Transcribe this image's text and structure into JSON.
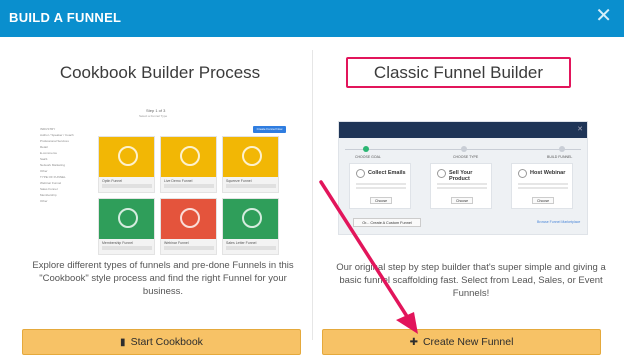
{
  "header": {
    "title": "BUILD A FUNNEL",
    "close_icon": "close-icon"
  },
  "left": {
    "title": "Cookbook Builder Process",
    "description": "Explore different types of funnels and pre-done Funnels in this \"Cookbook\" style process and find the right Funnel for your business.",
    "button_label": "Start Cookbook",
    "button_icon": "book-icon",
    "preview": {
      "step": "Step 1 of 3",
      "subtitle": "Select a Funnel Type",
      "corner_button": "Create Funnel Now",
      "sidebar": [
        "INDUSTRY",
        "Author / Speaker / Coach",
        "Professional Services",
        "Retail",
        "E-commerce",
        "SaaS",
        "Network Marketing",
        "Other",
        "TYPE OF FUNNEL",
        "Webinar Funnel",
        "Sales Funnel",
        "Membership",
        "Other"
      ],
      "cards": [
        {
          "label": "Optin Funnel",
          "color": "#f2b705"
        },
        {
          "label": "Live Demo Funnel",
          "color": "#f2b705"
        },
        {
          "label": "Squeeze Funnel",
          "color": "#f2b705"
        },
        {
          "label": "Membership Funnel",
          "color": "#2f9e5a"
        },
        {
          "label": "Webinar Funnel",
          "color": "#e4543c"
        },
        {
          "label": "Sales Letter Funnel",
          "color": "#2f9e5a"
        }
      ]
    }
  },
  "right": {
    "title": "Classic Funnel Builder",
    "description": "Our original step by step builder that's super simple and giving a basic funnel scaffolding fast. Select from Lead, Sales, or Event Funnels!",
    "button_label": "Create New Funnel",
    "button_icon": "plus-icon",
    "preview": {
      "steps": [
        "CHOOSE GOAL",
        "CHOOSE TYPE",
        "BUILD FUNNEL"
      ],
      "cards": [
        {
          "name": "Collect Emails",
          "choose": "Choose"
        },
        {
          "name": "Sell Your Product",
          "choose": "Choose"
        },
        {
          "name": "Host Webinar",
          "choose": "Choose"
        }
      ],
      "custom_button": "Or... Create A Custom Funnel",
      "browse_link": "Browse Funnel Marketplace"
    }
  },
  "colors": {
    "header": "#0a8fce",
    "button": "#f7c266",
    "highlight": "#e2155b"
  }
}
